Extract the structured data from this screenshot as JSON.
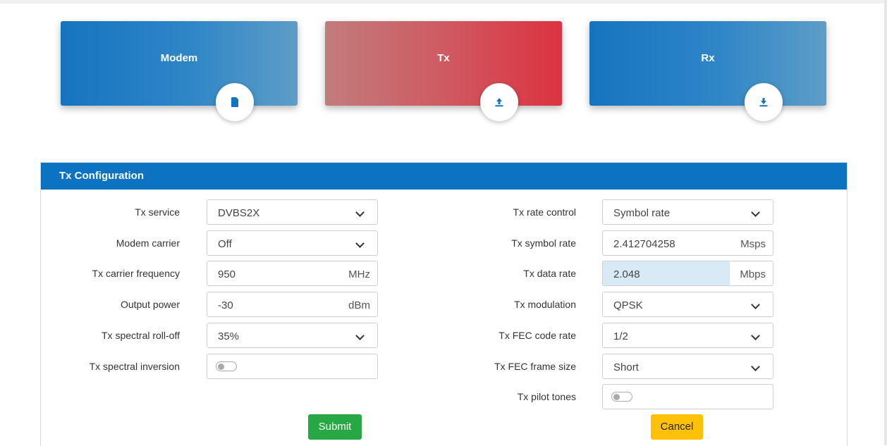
{
  "cards": {
    "modem": {
      "title": "Modem",
      "icon": "sim-card-icon"
    },
    "tx": {
      "title": "Tx",
      "icon": "upload-icon"
    },
    "rx": {
      "title": "Rx",
      "icon": "download-icon"
    }
  },
  "panel": {
    "title": "Tx Configuration",
    "header_color": "#0b73c2"
  },
  "left_fields": [
    {
      "label": "Tx service",
      "value": "DVBS2X",
      "type": "select"
    },
    {
      "label": "Modem carrier",
      "value": "Off",
      "type": "select"
    },
    {
      "label": "Tx carrier frequency",
      "value": "950",
      "unit": "MHz",
      "type": "input"
    },
    {
      "label": "Output power",
      "value": "-30",
      "unit": "dBm",
      "type": "input"
    },
    {
      "label": "Tx spectral roll-off",
      "value": "35%",
      "type": "select"
    },
    {
      "label": "Tx spectral inversion",
      "type": "toggle",
      "state": "off"
    }
  ],
  "right_fields": [
    {
      "label": "Tx rate control",
      "value": "Symbol rate",
      "type": "select"
    },
    {
      "label": "Tx symbol rate",
      "value": "2.412704258",
      "unit": "Msps",
      "type": "input"
    },
    {
      "label": "Tx data rate",
      "value": "2.048",
      "unit": "Mbps",
      "type": "readonly"
    },
    {
      "label": "Tx modulation",
      "value": "QPSK",
      "type": "select"
    },
    {
      "label": "Tx FEC code rate",
      "value": "1/2",
      "type": "select"
    },
    {
      "label": "Tx FEC frame size",
      "value": "Short",
      "type": "select"
    },
    {
      "label": "Tx pilot tones",
      "type": "toggle",
      "state": "off"
    }
  ],
  "buttons": {
    "submit": "Submit",
    "cancel": "Cancel"
  },
  "colors": {
    "submit": "#28a745",
    "cancel": "#ffc107",
    "accent": "#0b73c2",
    "tx_card": "#dc3340"
  }
}
